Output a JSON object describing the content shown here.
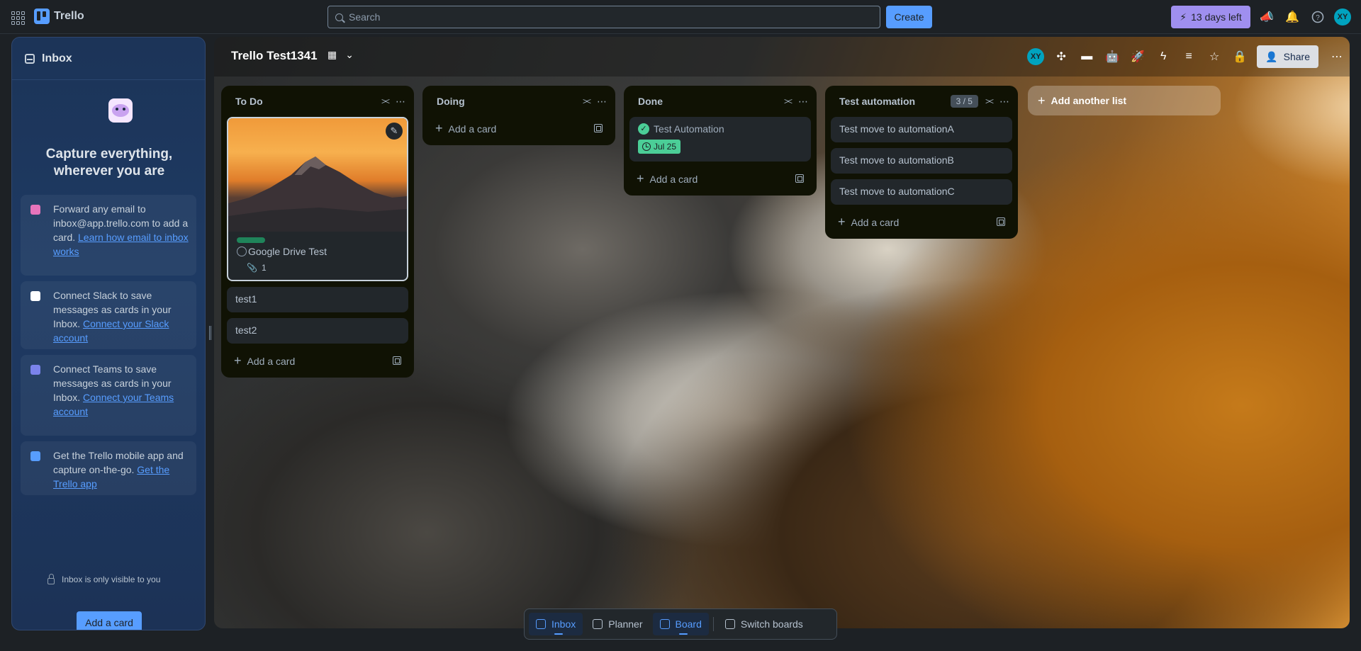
{
  "topnav": {
    "app_name": "Trello",
    "search_placeholder": "Search",
    "create_label": "Create",
    "trial_label": "13 days left",
    "avatar_initials": "XY",
    "icons": [
      "apps-grid-icon",
      "megaphone-icon",
      "bell-icon",
      "help-icon"
    ]
  },
  "inbox": {
    "title": "Inbox",
    "headline": "Capture everything, wherever you are",
    "tips": [
      {
        "text": "Forward any email to inbox@app.trello.com to add a card.",
        "link": "Learn how email to inbox works",
        "icon": "email-icon",
        "color": "#e774bb"
      },
      {
        "text": "Connect Slack to save messages as cards in your Inbox.",
        "link": "Connect your Slack account",
        "icon": "slack-icon",
        "color": "#ffffff"
      },
      {
        "text": "Connect Teams to save messages as cards in your Inbox.",
        "link": "Connect your Teams account",
        "icon": "teams-icon",
        "color": "#7b83eb"
      },
      {
        "text": "Get the Trello mobile app and capture on-the-go.",
        "link": "Get the Trello app",
        "icon": "mobile-app-icon",
        "color": "#579dff"
      }
    ],
    "visibility_note": "Inbox is only visible to you",
    "add_card_label": "Add a card"
  },
  "board": {
    "title": "Trello Test1341",
    "share_label": "Share",
    "member_initials": "XY",
    "add_list_label": "Add another list",
    "add_card_label": "Add a card",
    "lists": [
      {
        "title": "To Do",
        "image_card": {
          "title": "Google Drive Test",
          "attachments": "1",
          "label_color": "#1f845a"
        },
        "cards": [
          "test1",
          "test2"
        ]
      },
      {
        "title": "Doing",
        "cards": []
      },
      {
        "title": "Done",
        "done_card": {
          "title": "Test Automation",
          "due": "Jul 25"
        }
      },
      {
        "title": "Test automation",
        "limit": "3 / 5",
        "cards": [
          "Test move to automationA",
          "Test move to automationB",
          "Test move to automationC"
        ]
      }
    ]
  },
  "switcher": {
    "items": [
      {
        "label": "Inbox",
        "active": true
      },
      {
        "label": "Planner",
        "active": false
      },
      {
        "label": "Board",
        "active": true
      },
      {
        "label": "Switch boards",
        "active": false
      }
    ]
  },
  "colors": {
    "accent": "#579dff",
    "trial": "#9f8fef",
    "list_bg": "#101204",
    "card_bg": "#22272b",
    "done_green": "#4bce97"
  }
}
